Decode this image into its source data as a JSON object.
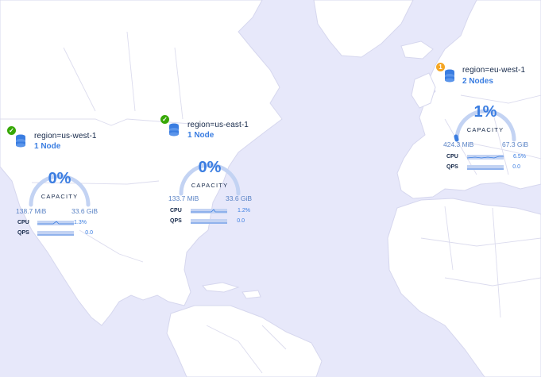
{
  "regions": [
    {
      "name": "region=us-west-1",
      "nodes": "1 Node",
      "status": "ok",
      "status_glyph": "✓",
      "capacity_percent": "0%",
      "capacity_fraction": 0.0,
      "capacity_label": "CAPACITY",
      "mem_used": "138.7 MiB",
      "mem_total": "33.6 GiB",
      "cpu_label": "CPU",
      "cpu_value": "1.3%",
      "qps_label": "QPS",
      "qps_value": "0.0"
    },
    {
      "name": "region=us-east-1",
      "nodes": "1 Node",
      "status": "ok",
      "status_glyph": "✓",
      "capacity_percent": "0%",
      "capacity_fraction": 0.0,
      "capacity_label": "CAPACITY",
      "mem_used": "133.7 MiB",
      "mem_total": "33.6 GiB",
      "cpu_label": "CPU",
      "cpu_value": "1.2%",
      "qps_label": "QPS",
      "qps_value": "0.0"
    },
    {
      "name": "region=eu-west-1",
      "nodes": "2 Nodes",
      "status": "warning",
      "status_glyph": "1",
      "capacity_percent": "1%",
      "capacity_fraction": 0.01,
      "capacity_label": "CAPACITY",
      "mem_used": "424.3 MiB",
      "mem_total": "67.3 GiB",
      "cpu_label": "CPU",
      "cpu_value": "6.5%",
      "qps_label": "QPS",
      "qps_value": "0.0"
    }
  ],
  "colors": {
    "ocean": "#e7e8fa",
    "land": "#ffffff",
    "accent": "#3a7de1",
    "gauge_track": "#c3d3f3",
    "ok": "#37a806",
    "warning": "#f5a623"
  },
  "icons": {
    "status_ok": "check-icon",
    "status_warning": "alert-count-icon",
    "region": "database-stack-icon"
  }
}
